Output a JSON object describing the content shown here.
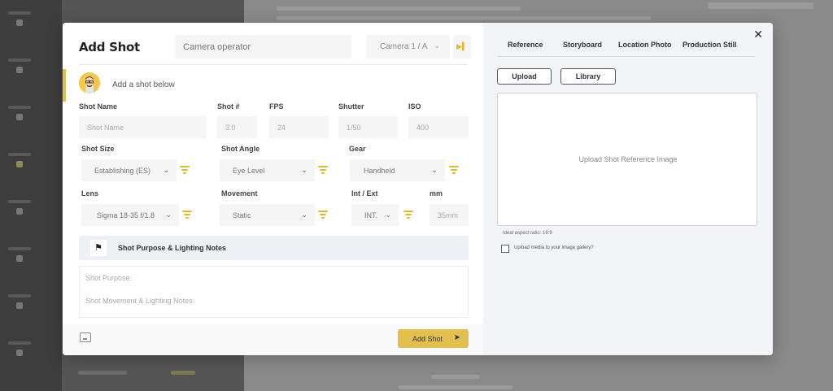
{
  "modal": {
    "title": "Add Shot",
    "camera_operator_placeholder": "Camera operator",
    "camera_select": "Camera 1 / A",
    "add_shot_below": "Add a shot below"
  },
  "labels": {
    "shot_name": "Shot Name",
    "shot_number": "Shot #",
    "fps": "FPS",
    "shutter": "Shutter",
    "iso": "ISO",
    "shot_size": "Shot Size",
    "shot_angle": "Shot Angle",
    "gear": "Gear",
    "lens": "Lens",
    "movement": "Movement",
    "int_ext": "Int / Ext",
    "mm": "mm"
  },
  "fields": {
    "shot_name_placeholder": "Shot Name",
    "shot_number": "3.0",
    "fps": "24",
    "shutter": "1/50",
    "iso": "400",
    "shot_size": "Establishing (ES)",
    "shot_angle": "Eye Level",
    "gear": "Handheld",
    "lens": "Sigma 18-35 f/1.8",
    "movement": "Static",
    "int_ext": "INT.",
    "mm": "35mm"
  },
  "notes": {
    "section_title": "Shot Purpose & Lighting Notes",
    "purpose_placeholder": "Shot Purpose:",
    "movement_placeholder": "Shot Movement & Lighting Notes:"
  },
  "footer": {
    "add_shot_label": "Add Shot"
  },
  "reference": {
    "tabs": [
      "Reference",
      "Storyboard",
      "Location Photo",
      "Production Still"
    ],
    "upload_label": "Upload",
    "library_label": "Library",
    "dropzone_text": "Upload Shot Reference Image",
    "aspect_ratio": "Ideal aspect ratio: 16:9",
    "gallery_checkbox": "Upload media to your image gallery?",
    "gallery_checked": false
  },
  "colors": {
    "accent": "#e3bf46",
    "right_panel_bg": "#f3f4f8"
  }
}
